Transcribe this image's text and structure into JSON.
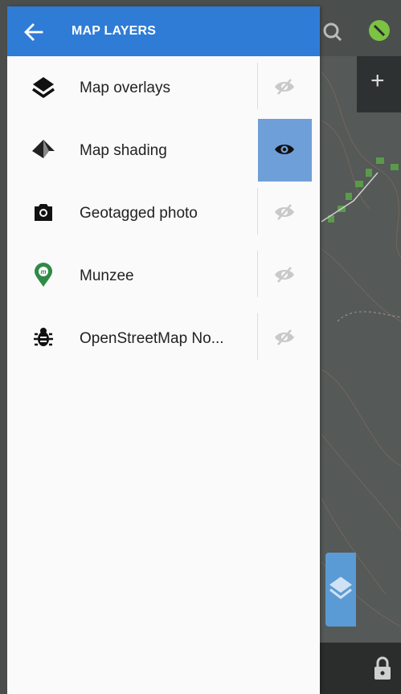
{
  "header": {
    "title": "MAP LAYERS"
  },
  "layers": [
    {
      "label": "Map overlays",
      "icon": "layers-icon",
      "visible": false
    },
    {
      "label": "Map shading",
      "icon": "mountain-icon",
      "visible": true
    },
    {
      "label": "Geotagged photo",
      "icon": "camera-icon",
      "visible": false
    },
    {
      "label": "Munzee",
      "icon": "munzee-pin-icon",
      "visible": false
    },
    {
      "label": "OpenStreetMap No...",
      "icon": "bug-icon",
      "visible": false
    }
  ],
  "map": {
    "plus_label": "+"
  },
  "colors": {
    "header": "#2e7cd6",
    "toggle_active": "#6f9fd9",
    "munzee": "#2f8a46"
  }
}
